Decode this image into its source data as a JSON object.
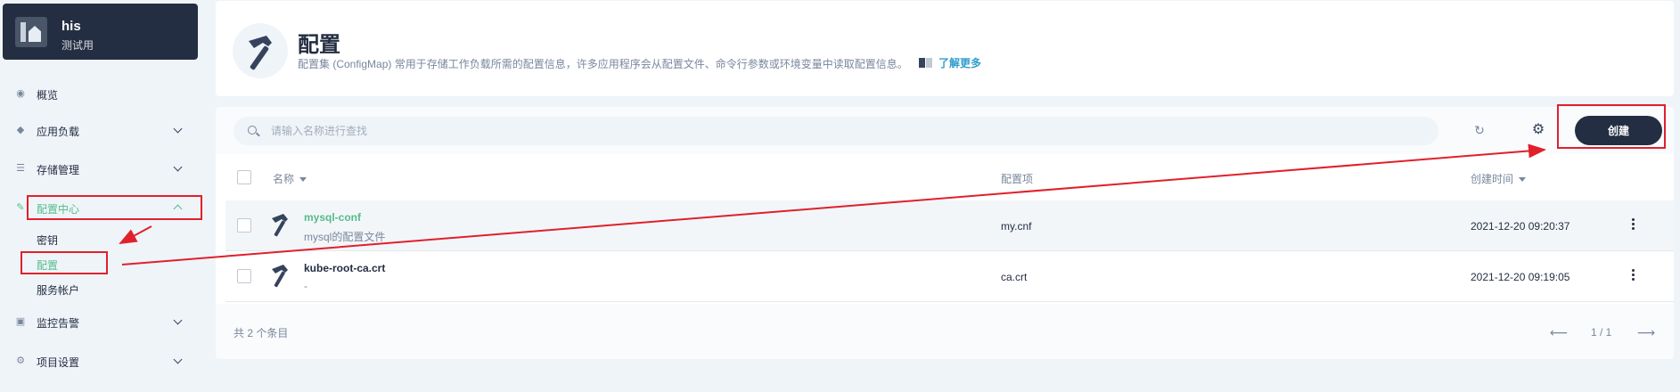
{
  "project": {
    "name": "his",
    "description": "测试用"
  },
  "sidebar": {
    "items": [
      {
        "label": "概览",
        "icon": "overview-icon"
      },
      {
        "label": "应用负载",
        "icon": "layers-icon"
      },
      {
        "label": "存储管理",
        "icon": "storage-icon"
      },
      {
        "label": "配置中心",
        "icon": "wrench-icon"
      },
      {
        "label": "监控告警",
        "icon": "monitor-icon"
      },
      {
        "label": "项目设置",
        "icon": "gear-icon"
      }
    ],
    "config_subitems": [
      {
        "label": "密钥"
      },
      {
        "label": "配置"
      },
      {
        "label": "服务帐户"
      }
    ]
  },
  "banner": {
    "title": "配置",
    "description": "配置集 (ConfigMap) 常用于存储工作负载所需的配置信息，许多应用程序会从配置文件、命令行参数或环境变量中读取配置信息。",
    "learn_more": "了解更多"
  },
  "toolbar": {
    "search_placeholder": "请输入名称进行查找",
    "create_label": "创建"
  },
  "table": {
    "columns": [
      "名称",
      "配置项",
      "创建时间"
    ],
    "rows": [
      {
        "name": "mysql-conf",
        "desc": "mysql的配置文件",
        "items": "my.cnf",
        "created": "2021-12-20 09:20:37"
      },
      {
        "name": "kube-root-ca.crt",
        "desc": "-",
        "items": "ca.crt",
        "created": "2021-12-20 09:19:05"
      }
    ]
  },
  "footer": {
    "total": "共 2 个条目",
    "page": "1 / 1"
  },
  "colors": {
    "accent": "#55bc8a",
    "dark": "#242e42",
    "annotation": "#e0202b"
  }
}
